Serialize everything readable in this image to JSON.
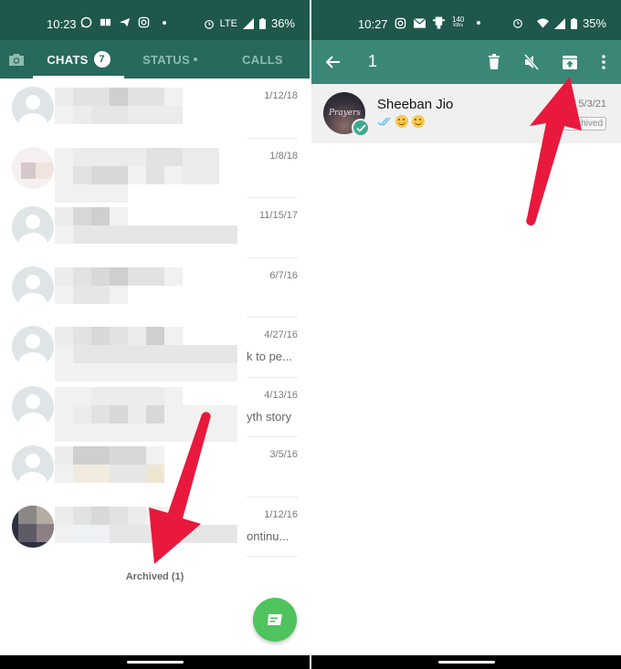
{
  "left": {
    "status_bar": {
      "time": "10:23",
      "notification_icons": [
        "whatsapp-icon",
        "book-icon",
        "telegram-icon",
        "instagram-icon"
      ],
      "network": "LTE",
      "battery": "36%"
    },
    "tabs": [
      {
        "id": "camera",
        "icon": "camera-icon"
      },
      {
        "id": "chats",
        "label": "CHATS",
        "badge": "7",
        "active": true
      },
      {
        "id": "status",
        "label": "STATUS",
        "has_dot": true
      },
      {
        "id": "calls",
        "label": "CALLS"
      }
    ],
    "chats": [
      {
        "date": "1/12/18",
        "preview": ""
      },
      {
        "date": "1/8/18",
        "preview": ""
      },
      {
        "date": "11/15/17",
        "preview": ""
      },
      {
        "date": "6/7/16",
        "preview": ""
      },
      {
        "date": "4/27/16",
        "preview": "k to pe..."
      },
      {
        "date": "4/13/16",
        "preview": "yth story"
      },
      {
        "date": "3/5/16",
        "preview": ""
      },
      {
        "date": "1/12/16",
        "preview": "ontinu..."
      }
    ],
    "archived_label": "Archived (1)",
    "fab_icon": "new-chat-icon"
  },
  "right": {
    "status_bar": {
      "time": "10:27",
      "notification_icons": [
        "instagram-icon",
        "mail-icon",
        "download-icon"
      ],
      "data_speed": "140",
      "data_speed_unit": "KB/s",
      "battery": "35%"
    },
    "action_bar": {
      "selected_count": "1",
      "actions": [
        "delete-icon",
        "mute-icon",
        "unarchive-icon",
        "more-icon"
      ]
    },
    "selected_chat": {
      "name": "Sheeban Jio",
      "avatar_text": "Prayers",
      "message_emoji": "😊😊",
      "date": "5/3/21",
      "badge": "Archived"
    }
  },
  "colors": {
    "status_bar": "#1f574c",
    "tab_bar": "#27695c",
    "action_bar": "#3a8778",
    "fab": "#4fc35d",
    "arrow": "#e8193c",
    "read_ticks": "#4fb6ec"
  }
}
